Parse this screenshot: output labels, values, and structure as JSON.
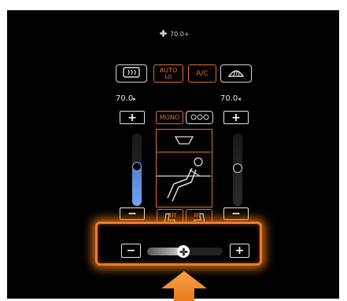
{
  "status": {
    "fan_text": "70.0+"
  },
  "top_buttons": {
    "rear_defrost_icon": "rear-defrost-icon",
    "auto_label": "AUTO",
    "auto_sub": "LO",
    "ac_label": "A/C",
    "front_defrost_icon": "front-defrost-icon"
  },
  "left_zone": {
    "temp": "70.0",
    "plus": "+",
    "minus": "−",
    "level": 0.6
  },
  "right_zone": {
    "temp": "70.0",
    "plus": "+",
    "minus": "−",
    "level": 0.0
  },
  "modes": {
    "mono": "MONO",
    "sync_icon": "climate-sync-icon"
  },
  "fan": {
    "minus": "−",
    "plus": "+",
    "level": 0.4
  },
  "colors": {
    "accent": "#e0702a",
    "highlight": "#f07a20",
    "blue": "#6aa6ff"
  }
}
